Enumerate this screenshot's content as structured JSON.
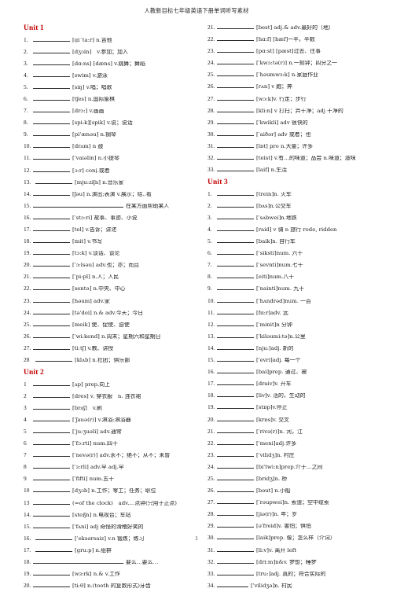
{
  "header": {
    "title": "人教新目标七年级英语下册单词听写素材"
  },
  "footer": {
    "page_number": "1"
  },
  "left_column": [
    {
      "type": "unit",
      "label": "Unit 1"
    },
    {
      "type": "entry",
      "num": "1.",
      "text": "[gi´ta:r] n.吉他",
      "blank": "std"
    },
    {
      "type": "entry",
      "num": "2.",
      "text": "[dʒɔin]　v.参加；加入",
      "blank": "std"
    },
    {
      "type": "entry",
      "num": "3.",
      "text": "[dɑ:ns] [dæns] v.跳舞；舞蹈",
      "blank": "std"
    },
    {
      "type": "entry",
      "num": "4.",
      "text": "[swim] v.游泳",
      "blank": "std"
    },
    {
      "type": "entry",
      "num": "5.",
      "text": "[siŋ] v.唱；唱歌",
      "blank": "std"
    },
    {
      "type": "entry",
      "num": "6.",
      "text": "[tʃes] n.国际象棋",
      "blank": "std"
    },
    {
      "type": "entry",
      "num": "7.",
      "text": "[drɔ:] v.画画",
      "blank": "std"
    },
    {
      "type": "entry",
      "num": "8.",
      "text": "[spi:k][spik] v.说；说话",
      "blank": "std"
    },
    {
      "type": "entry",
      "num": "9.",
      "text": "[pi'ænəu] n.钢琴",
      "blank": "std"
    },
    {
      "type": "entry",
      "num": "10.",
      "text": "[drʌm] n 鼓",
      "blank": "std"
    },
    {
      "type": "entry",
      "num": "11.",
      "text": "[ˈvaiəlin] n.小提琴",
      "blank": "std"
    },
    {
      "type": "entry",
      "num": "12.",
      "text": "[ɔ:r] conj.或者",
      "blank": "std"
    },
    {
      "type": "entry",
      "num": "13.",
      "text": "[mju:ziʃn] n.音乐家",
      "blank": "std",
      "indent": true
    },
    {
      "type": "entry",
      "num": "14.",
      "text": "[ʃəu] n.演出;表演  v.展示；给..看",
      "blank": "std"
    },
    {
      "type": "entry",
      "num": "15.",
      "text": "在某方面帮助某人",
      "blank": "wide"
    },
    {
      "type": "entry",
      "num": "16.",
      "text": "[ˈstɔ:ri] 故事、事迹、小说",
      "blank": "std"
    },
    {
      "type": "entry",
      "num": "17.",
      "text": "[tel] v.告诉；讲述",
      "blank": "std"
    },
    {
      "type": "entry",
      "num": "18.",
      "text": "[mit] v.书写",
      "blank": "std"
    },
    {
      "type": "entry",
      "num": "19.",
      "text": "[tɔ:k] v.谈话、谈论",
      "blank": "std"
    },
    {
      "type": "entry",
      "num": "20.",
      "text": "[ˈɔ:lsəu] adv.也；亦；而且",
      "blank": "std"
    },
    {
      "type": "entry",
      "num": "21.",
      "text": "[ˈpi:pl] n.人；人民",
      "blank": "std"
    },
    {
      "type": "entry",
      "num": "22.",
      "text": "[sentə] n.中央、中心",
      "blank": "std"
    },
    {
      "type": "entry",
      "num": "23.",
      "text": "[həum] adv.家",
      "blank": "std"
    },
    {
      "type": "entry",
      "num": "24.",
      "text": "[tə'dei] n.& adv.今天；今日",
      "blank": "std"
    },
    {
      "type": "entry",
      "num": "25.",
      "text": "[meik] 使、促使、迫使",
      "blank": "std"
    },
    {
      "type": "entry",
      "num": "26.",
      "text": "[ˈwi:kend] n.周末；星期六和星期日",
      "blank": "std"
    },
    {
      "type": "entry",
      "num": "27.",
      "text": "[tiːtʃ] v.教、讲授",
      "blank": "std"
    },
    {
      "type": "entry",
      "num": "28",
      "text": "[klʌb] n.社团；俱乐部",
      "blank": "std",
      "indent": true
    },
    {
      "type": "unit",
      "label": "Unit 2"
    },
    {
      "type": "entry",
      "num": "1",
      "text": "[ʌp] prep.向上",
      "blank": "std"
    },
    {
      "type": "entry",
      "num": "2",
      "text": "[dres] v. 穿衣服　n. 连衣裙",
      "blank": "std"
    },
    {
      "type": "entry",
      "num": "3",
      "text": "[brʌʃ]　v.刷",
      "blank": "std"
    },
    {
      "type": "entry",
      "num": "4",
      "text": "[ˈʃauə(r)] v.淋浴:淋浴器",
      "blank": "std"
    },
    {
      "type": "entry",
      "num": "5",
      "text": "[ˈju:ʒuəli] adv.通常",
      "blank": "std"
    },
    {
      "type": "entry",
      "num": "6",
      "text": "[ˈfɔ:rti] num.四十",
      "blank": "std"
    },
    {
      "type": "entry",
      "num": "7",
      "text": "[ˈnevə(r)] adv.永不；绝不；从不；未曾",
      "blank": "std"
    },
    {
      "type": "entry",
      "num": "8",
      "text": "[ˈɜ:rli] adv.早  adj.早",
      "blank": "std"
    },
    {
      "type": "entry",
      "num": "9",
      "text": "[ˈfifti]  num.五十",
      "blank": "std"
    },
    {
      "type": "entry",
      "num": "10",
      "text": "[dʒɔb] n.工作；零工；任务；职位",
      "blank": "std"
    },
    {
      "type": "entry",
      "num": "13",
      "text": "(=of the clock)　adv.…点钟(只用于正点)",
      "blank": "std"
    },
    {
      "type": "entry",
      "num": "14.",
      "text": "[steiʃn] n.电视台；车站",
      "blank": "std"
    },
    {
      "type": "entry",
      "num": "15.",
      "text": "[ˈfʌni] adj 奇怪的滑稽好笑的",
      "blank": "std"
    },
    {
      "type": "entry",
      "num": "16.",
      "text": "[ˈeksərsaiz] v.n 锻炼；练习",
      "blank": "std",
      "indent": true
    },
    {
      "type": "entry",
      "num": "17.",
      "text": "[gru:p] n.组群",
      "blank": "std",
      "indent": true
    },
    {
      "type": "entry",
      "num": "18.",
      "text": "要么…要么…",
      "blank": "wide"
    },
    {
      "type": "entry",
      "num": "19.",
      "text": "[wɜ:rk] n.& v.工作",
      "blank": "std"
    },
    {
      "type": "entry",
      "num": "20.",
      "text": "[ti:θ] n.(tooth 的复数形式)牙齿",
      "blank": "std"
    }
  ],
  "right_column": [
    {
      "type": "entry",
      "num": "21.",
      "text": "[best] adj.& adv.最好的（地）",
      "blank": "std"
    },
    {
      "type": "entry",
      "num": "22.",
      "text": "[hɑ:f] [hæf]一半，半数",
      "blank": "std"
    },
    {
      "type": "entry",
      "num": "23.",
      "text": "[pɑ:st] [pæst]过去、往事",
      "blank": "std"
    },
    {
      "type": "entry",
      "num": "24.",
      "text": "[ˈkwɔ:tə(r)] n.一刻钟；四分之一",
      "blank": "std"
    },
    {
      "type": "entry",
      "num": "25.",
      "text": "[ˈhəumwɜ:k] n.家庭作业",
      "blank": "std"
    },
    {
      "type": "entry",
      "num": "26.",
      "text": "[rʌn] v 跑；奔",
      "blank": "std"
    },
    {
      "type": "entry",
      "num": "27.",
      "text": "[wɔ:k]v. 行走；步行",
      "blank": "std"
    },
    {
      "type": "entry",
      "num": "28.",
      "text": "[kli:n] v 打扫；弄干净；adj 干净的",
      "blank": "std"
    },
    {
      "type": "entry",
      "num": "29.",
      "text": "[ˈkwikli] adv 很快的",
      "blank": "std"
    },
    {
      "type": "entry",
      "num": "30.",
      "text": "[ˈaiðər] adv 或者；也",
      "blank": "std"
    },
    {
      "type": "entry",
      "num": "31.",
      "text": "[lɒt] pro n.大量；许多",
      "blank": "std"
    },
    {
      "type": "entry",
      "num": "32.",
      "text": "[teist] v.有…的味道；品尝 n.味道；滋味",
      "blank": "std"
    },
    {
      "type": "entry",
      "num": "33.",
      "text": "[laif] n.生活",
      "blank": "std"
    },
    {
      "type": "unit",
      "label": "Unit 3"
    },
    {
      "type": "entry",
      "num": "1.",
      "text": "[trein]n. 火车",
      "blank": "std"
    },
    {
      "type": "entry",
      "num": "2.",
      "text": "[bʌs]n.公交车",
      "blank": "std"
    },
    {
      "type": "entry",
      "num": "3.",
      "text": "[ˈsʌbwei]n.地铁",
      "blank": "std"
    },
    {
      "type": "entry",
      "num": "4.",
      "text": "[raid] v 骑  n 旅行 rode, ridden",
      "blank": "std"
    },
    {
      "type": "entry",
      "num": "5.",
      "text": "[baik]n. 自行车",
      "blank": "std"
    },
    {
      "type": "entry",
      "num": "6.",
      "text": "[ˈsiksti]num. 六十",
      "blank": "std"
    },
    {
      "type": "entry",
      "num": "7.",
      "text": "[ˈsevnti]num.七十",
      "blank": "std"
    },
    {
      "type": "entry",
      "num": "8.",
      "text": "[eiti]num.八十",
      "blank": "std"
    },
    {
      "type": "entry",
      "num": "9.",
      "text": "[ˈnainti]num. 九十",
      "blank": "std"
    },
    {
      "type": "entry",
      "num": "10.",
      "text": "[ˈhʌndrəd]num. 一百",
      "blank": "std"
    },
    {
      "type": "entry",
      "num": "11.",
      "text": "[fɑ:r]adv. 远",
      "blank": "std"
    },
    {
      "type": "entry",
      "num": "12.",
      "text": "[ˈminit]n 分钟",
      "blank": "std"
    },
    {
      "type": "entry",
      "num": "13.",
      "text": "[ˈkiləumi:tə]n.公里",
      "blank": "std"
    },
    {
      "type": "entry",
      "num": "14.",
      "text": "[nju:]adj. 新的",
      "blank": "std"
    },
    {
      "type": "entry",
      "num": "15.",
      "text": "[ˈevri]adj. 每一个",
      "blank": "std"
    },
    {
      "type": "entry",
      "num": "16.",
      "text": "[bai]prep. 通过、被",
      "blank": "std"
    },
    {
      "type": "entry",
      "num": "17.",
      "text": "[draiv]v. 开车",
      "blank": "std"
    },
    {
      "type": "entry",
      "num": "18.",
      "text": "[liv]v. 活的，生动的",
      "blank": "std"
    },
    {
      "type": "entry",
      "num": "19.",
      "text": "[stɒp]v.停止",
      "blank": "std"
    },
    {
      "type": "entry",
      "num": "20.",
      "text": "[krɒs]v. 交叉",
      "blank": "std"
    },
    {
      "type": "entry",
      "num": "21.",
      "text": "[ˈrivə(r)]n. 河，江",
      "blank": "std"
    },
    {
      "type": "entry",
      "num": "22.",
      "text": "[ˈmeni]adj.许多",
      "blank": "std"
    },
    {
      "type": "entry",
      "num": "23.",
      "text": "[ˈvilidʒ]n. 村庄",
      "blank": "std"
    },
    {
      "type": "entry",
      "num": "24.",
      "text": "[biˈtwi:n]prep.介于…之间",
      "blank": "std"
    },
    {
      "type": "entry",
      "num": "25.",
      "text": "[bridʒ]n. 桥",
      "blank": "std"
    },
    {
      "type": "entry",
      "num": "26.",
      "text": "[bəut] n.小船",
      "blank": "std"
    },
    {
      "type": "entry",
      "num": "27.",
      "text": "[ˈrəupwei]n. 索道；空中缆索",
      "blank": "std"
    },
    {
      "type": "entry",
      "num": "28.",
      "text": "[jiə(r)]n. 年；岁",
      "blank": "std"
    },
    {
      "type": "entry",
      "num": "29.",
      "text": "[əˈfreid]v. 害怕；惧怕",
      "blank": "std"
    },
    {
      "type": "entry",
      "num": "30.",
      "text": "[laik]prep. 像；怎么样（介词）",
      "blank": "std"
    },
    {
      "type": "entry",
      "num": "31.",
      "text": "[li:v]v. 离开 left",
      "blank": "std"
    },
    {
      "type": "entry",
      "num": "32.",
      "text": "[dri:m]n&v. 梦想；睡梦",
      "blank": "std"
    },
    {
      "type": "entry",
      "num": "33.",
      "text": "[tru:]adj. 真的；符合实际的",
      "blank": "std"
    },
    {
      "type": "entry",
      "num": "34.",
      "text": "[ˈvilidʒə]n. 村民",
      "blank": "sm"
    }
  ]
}
